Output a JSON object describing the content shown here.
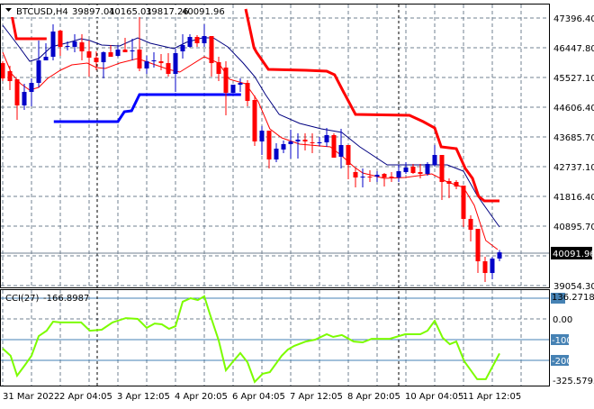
{
  "header": {
    "symbol": "BTCUSD,H4",
    "open": "39897.01",
    "high": "40165.01",
    "low": "39817.26",
    "close": "40091.96"
  },
  "cci_label": {
    "name": "CCI(27)",
    "value": "-166.8987"
  },
  "price_axis": [
    "47396.40",
    "46447.80",
    "45527.10",
    "44606.40",
    "43685.70",
    "42737.10",
    "41816.40",
    "40895.70",
    "39054.30"
  ],
  "current_price_label": "40091.96",
  "cci_axis": {
    "max": "136.2718",
    "zero": "0.00",
    "m100": "-100",
    "m200": "-200",
    "min": "-325.5795"
  },
  "time_axis": [
    "31 Mar 2022",
    "2 Apr 04:05",
    "3 Apr 12:05",
    "4 Apr 20:05",
    "6 Apr 04:05",
    "7 Apr 12:05",
    "8 Apr 20:05",
    "10 Apr 04:05",
    "11 Apr 12:05"
  ],
  "colors": {
    "bull": "#0000c8",
    "bear": "#ff0000",
    "ma_upper": "#000080",
    "ma_lower": "#ff0000",
    "stop_red": "#ff0000",
    "stop_blue": "#0000ff",
    "cci": "#7cfc00",
    "levels": "#4682b4"
  },
  "chart_data": {
    "type": "candlestick",
    "symbol": "BTCUSD",
    "timeframe": "H4",
    "price_range": [
      39054.3,
      47396.4
    ],
    "time_tick_bar_index": [
      0,
      8,
      16,
      24,
      32,
      40,
      48,
      56,
      64
    ],
    "ohlc": [
      [
        45991,
        46047,
        45430,
        45514
      ],
      [
        45739,
        45907,
        45149,
        45430
      ],
      [
        45486,
        45486,
        44222,
        44671
      ],
      [
        44671,
        45346,
        44531,
        45093
      ],
      [
        45093,
        45514,
        44643,
        45374
      ],
      [
        45374,
        46694,
        45233,
        46076
      ],
      [
        46076,
        46610,
        46076,
        46188
      ],
      [
        46188,
        47200,
        46076,
        46975
      ],
      [
        47003,
        47031,
        46216,
        46497
      ],
      [
        46497,
        46666,
        46385,
        46525
      ],
      [
        46497,
        46891,
        46329,
        46666
      ],
      [
        46638,
        46891,
        46076,
        46357
      ],
      [
        46357,
        46694,
        45570,
        46160
      ],
      [
        46160,
        46357,
        45767,
        46019
      ],
      [
        46019,
        46357,
        45514,
        46329
      ],
      [
        46329,
        46554,
        46188,
        46188
      ],
      [
        46216,
        46554,
        46188,
        46413
      ],
      [
        46413,
        46778,
        46329,
        46329
      ],
      [
        46357,
        46750,
        46076,
        46385
      ],
      [
        46413,
        47452,
        45739,
        45823
      ],
      [
        45823,
        46216,
        45655,
        46047
      ],
      [
        46047,
        46329,
        45851,
        46076
      ],
      [
        46047,
        46273,
        45767,
        45991
      ],
      [
        45991,
        46301,
        45570,
        45655
      ],
      [
        45655,
        46441,
        45093,
        46301
      ],
      [
        46357,
        46891,
        46132,
        46554
      ],
      [
        46497,
        46891,
        46469,
        46806
      ],
      [
        46806,
        46863,
        46497,
        46610
      ],
      [
        46610,
        47200,
        46497,
        46834
      ],
      [
        46834,
        46834,
        45570,
        45991
      ],
      [
        46019,
        46188,
        45430,
        45655
      ],
      [
        45851,
        46047,
        44362,
        45065
      ],
      [
        45065,
        45318,
        45065,
        45318
      ],
      [
        45318,
        45514,
        45093,
        45374
      ],
      [
        45374,
        45458,
        44643,
        44812
      ],
      [
        44840,
        44980,
        43407,
        43548
      ],
      [
        43548,
        44025,
        43127,
        43885
      ],
      [
        43885,
        43885,
        42705,
        42986
      ],
      [
        42986,
        43492,
        42902,
        43323
      ],
      [
        43295,
        43576,
        43183,
        43464
      ],
      [
        43464,
        43913,
        43014,
        43548
      ],
      [
        43548,
        43801,
        43014,
        43604
      ],
      [
        43604,
        43801,
        43267,
        43548
      ],
      [
        43520,
        43801,
        43183,
        43492
      ],
      [
        43492,
        43688,
        43407,
        43520
      ],
      [
        43520,
        43969,
        43379,
        43745
      ],
      [
        43745,
        43801,
        43042,
        43042
      ],
      [
        43071,
        43941,
        42705,
        43436
      ],
      [
        43436,
        43436,
        42368,
        42818
      ],
      [
        42593,
        42733,
        42115,
        42424
      ],
      [
        42424,
        42705,
        42115,
        42452
      ],
      [
        42452,
        42649,
        42284,
        42424
      ],
      [
        42452,
        42621,
        42284,
        42509
      ],
      [
        42537,
        42565,
        42143,
        42424
      ],
      [
        42452,
        42593,
        42284,
        42424
      ],
      [
        42424,
        42818,
        42284,
        42621
      ],
      [
        42593,
        42902,
        42537,
        42733
      ],
      [
        42761,
        42846,
        42537,
        42565
      ],
      [
        42593,
        42846,
        42396,
        42537
      ],
      [
        42537,
        42902,
        42481,
        42846
      ],
      [
        42818,
        43436,
        42761,
        43127
      ],
      [
        43127,
        43127,
        41722,
        42284
      ],
      [
        42312,
        42396,
        41778,
        42228
      ],
      [
        42284,
        42340,
        42059,
        42143
      ],
      [
        42171,
        42171,
        40880,
        41133
      ],
      [
        41133,
        41245,
        40430,
        40795
      ],
      [
        40824,
        40824,
        39447,
        39812
      ],
      [
        39812,
        39952,
        39166,
        39447
      ],
      [
        39447,
        39952,
        39250,
        39896
      ],
      [
        39897.01,
        40165.01,
        39817.26,
        40091.96
      ]
    ],
    "ma_upper": [
      [
        0,
        47172
      ],
      [
        2.1,
        46554
      ],
      [
        3.75,
        46047
      ],
      [
        5,
        46132
      ],
      [
        6.75,
        46497
      ],
      [
        9.25,
        46638
      ],
      [
        10.9,
        46750
      ],
      [
        12.1,
        46694
      ],
      [
        13.75,
        46554
      ],
      [
        16.25,
        46525
      ],
      [
        18.75,
        46778
      ],
      [
        20.5,
        46610
      ],
      [
        23.75,
        46441
      ],
      [
        25.5,
        46638
      ],
      [
        27.75,
        46778
      ],
      [
        29.25,
        46778
      ],
      [
        31.25,
        46497
      ],
      [
        33.4,
        45991
      ],
      [
        35,
        45570
      ],
      [
        36.5,
        45009
      ],
      [
        38.4,
        44390
      ],
      [
        41.25,
        44110
      ],
      [
        44.25,
        43941
      ],
      [
        47.1,
        43829
      ],
      [
        49.6,
        43379
      ],
      [
        53.4,
        42818
      ],
      [
        59.25,
        42818
      ],
      [
        61.75,
        42818
      ],
      [
        64,
        42621
      ],
      [
        65.9,
        41862
      ],
      [
        69,
        40880
      ]
    ],
    "ma_lower": [
      [
        0,
        46329
      ],
      [
        1.25,
        45655
      ],
      [
        2.5,
        45346
      ],
      [
        3.75,
        45149
      ],
      [
        5,
        45233
      ],
      [
        6.25,
        45514
      ],
      [
        8,
        45767
      ],
      [
        9.6,
        45936
      ],
      [
        11.75,
        45991
      ],
      [
        13,
        45851
      ],
      [
        14.25,
        45823
      ],
      [
        16.25,
        45991
      ],
      [
        18.75,
        46132
      ],
      [
        20.5,
        45991
      ],
      [
        23,
        45795
      ],
      [
        24.6,
        45711
      ],
      [
        28,
        46188
      ],
      [
        30,
        45991
      ],
      [
        31.5,
        45486
      ],
      [
        33.75,
        45346
      ],
      [
        35.5,
        44784
      ],
      [
        37.1,
        43941
      ],
      [
        38.75,
        43660
      ],
      [
        41.25,
        43464
      ],
      [
        45.5,
        43379
      ],
      [
        47.1,
        43098
      ],
      [
        48.75,
        42761
      ],
      [
        50,
        42565
      ],
      [
        53,
        42396
      ],
      [
        55.9,
        42424
      ],
      [
        59.6,
        42537
      ],
      [
        61.75,
        42284
      ],
      [
        64,
        42115
      ],
      [
        65.5,
        41553
      ],
      [
        67.1,
        40458
      ],
      [
        68.75,
        40177
      ]
    ],
    "stop_red": [
      [
        [
          1.1,
          47677
        ],
        [
          1.9,
          46750
        ],
        [
          6.1,
          46750
        ]
      ],
      [
        [
          33.75,
          47677
        ],
        [
          34.9,
          46469
        ],
        [
          35.25,
          46329
        ],
        [
          36.9,
          45795
        ],
        [
          42.1,
          45767
        ],
        [
          45,
          45739
        ],
        [
          46.1,
          45627
        ],
        [
          47.4,
          45065
        ],
        [
          49,
          44390
        ],
        [
          56.5,
          44362
        ],
        [
          58.4,
          44166
        ],
        [
          60,
          43969
        ],
        [
          60.9,
          43379
        ],
        [
          63,
          43323
        ],
        [
          64.25,
          42705
        ],
        [
          65.25,
          42396
        ],
        [
          66.1,
          41834
        ],
        [
          66.9,
          41694
        ],
        [
          69,
          41694
        ]
      ]
    ],
    "stop_blue": [
      [
        7.1,
        44166
      ],
      [
        16,
        44166
      ],
      [
        16.9,
        44474
      ],
      [
        17.9,
        44503
      ],
      [
        19,
        45009
      ],
      [
        33.1,
        45009
      ]
    ],
    "cci": {
      "period": 27,
      "range": [
        -325.5795,
        136.2718
      ],
      "levels": [
        100,
        0,
        -100,
        -200
      ],
      "values": [
        [
          0,
          -143
        ],
        [
          1.1,
          -178
        ],
        [
          2,
          -274
        ],
        [
          3.1,
          -222
        ],
        [
          4,
          -178
        ],
        [
          5,
          -83
        ],
        [
          6.1,
          -57
        ],
        [
          7,
          -13
        ],
        [
          8,
          -17
        ],
        [
          10.9,
          -17
        ],
        [
          12.1,
          -57
        ],
        [
          13.75,
          -52
        ],
        [
          15.25,
          -17
        ],
        [
          17.1,
          4
        ],
        [
          18.75,
          0
        ],
        [
          20,
          -43
        ],
        [
          21.1,
          -22
        ],
        [
          22.1,
          -26
        ],
        [
          23.1,
          -48
        ],
        [
          24,
          -35
        ],
        [
          25,
          83
        ],
        [
          26.1,
          100
        ],
        [
          27.1,
          91
        ],
        [
          28,
          109
        ],
        [
          28.75,
          26
        ],
        [
          30,
          -104
        ],
        [
          31,
          -248
        ],
        [
          31.9,
          -209
        ],
        [
          33,
          -165
        ],
        [
          34,
          -209
        ],
        [
          35,
          -304
        ],
        [
          36.1,
          -265
        ],
        [
          37.1,
          -257
        ],
        [
          38.75,
          -178
        ],
        [
          39.6,
          -148
        ],
        [
          40.5,
          -130
        ],
        [
          42.1,
          -109
        ],
        [
          43.4,
          -100
        ],
        [
          45,
          -74
        ],
        [
          45.9,
          -87
        ],
        [
          47.1,
          -78
        ],
        [
          48.75,
          -109
        ],
        [
          50,
          -113
        ],
        [
          51.25,
          -96
        ],
        [
          53.75,
          -96
        ],
        [
          55.9,
          -74
        ],
        [
          58,
          -74
        ],
        [
          59,
          -57
        ],
        [
          60,
          -9
        ],
        [
          61.1,
          -91
        ],
        [
          62.1,
          -122
        ],
        [
          63,
          -109
        ],
        [
          64.1,
          -204
        ],
        [
          65.9,
          -291
        ],
        [
          67.1,
          -291
        ],
        [
          69,
          -166.9
        ]
      ]
    }
  }
}
